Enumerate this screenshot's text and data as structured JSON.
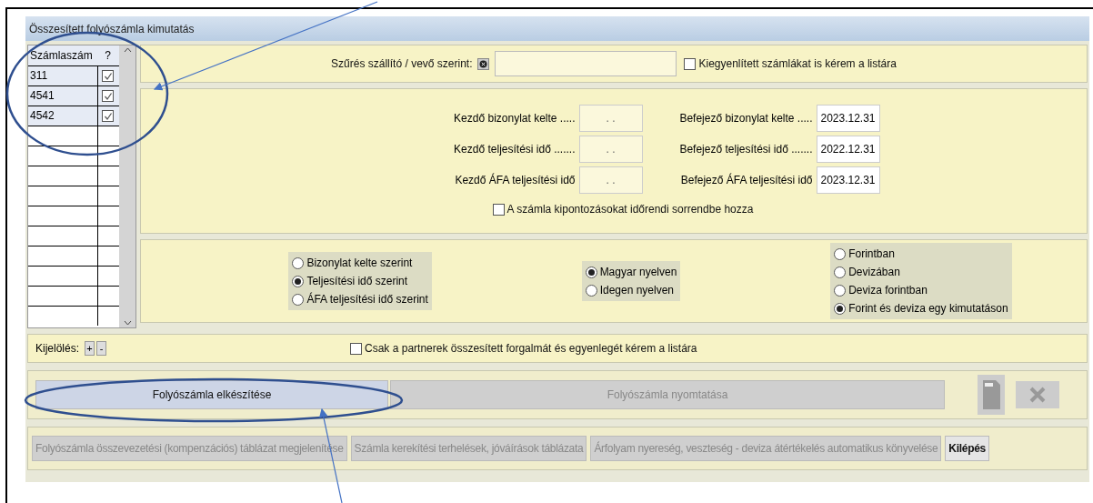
{
  "window": {
    "title": "Összesített folyószámla kimutatás"
  },
  "accounts_table": {
    "columns": [
      "Számlaszám",
      "?"
    ],
    "rows": [
      {
        "number": "311",
        "checked": true
      },
      {
        "number": "4541",
        "checked": true
      },
      {
        "number": "4542",
        "checked": true
      }
    ]
  },
  "filter": {
    "label": "Szűrés szállító / vevő szerint:",
    "checkbox": {
      "label": "Kiegyenlített számlákat is kérem a listára",
      "checked": false
    }
  },
  "dates": {
    "rows": [
      {
        "start_label": "Kezdő bizonylat kelte .....",
        "start_value": ". .",
        "end_label": "Befejező bizonylat kelte .....",
        "end_value": "2023.12.31"
      },
      {
        "start_label": "Kezdő teljesítési idő .......",
        "start_value": ". .",
        "end_label": "Befejező teljesítési idő .......",
        "end_value": "2022.12.31"
      },
      {
        "start_label": "Kezdő ÁFA teljesítési idő",
        "start_value": ". .",
        "end_label": "Befejező ÁFA teljesítési idő",
        "end_value": "2023.12.31"
      }
    ],
    "checkbox": {
      "label": "A számla kipontozásokat időrendi sorrendbe hozza",
      "checked": false
    }
  },
  "radio_groups": [
    {
      "options": [
        {
          "label": "Bizonylat kelte szerint",
          "selected": false
        },
        {
          "label": "Teljesítési idő szerint",
          "selected": true
        },
        {
          "label": "ÁFA teljesítési idő szerint",
          "selected": false
        }
      ]
    },
    {
      "options": [
        {
          "label": "Magyar nyelven",
          "selected": true
        },
        {
          "label": "Idegen nyelven",
          "selected": false
        }
      ]
    },
    {
      "options": [
        {
          "label": "Forintban",
          "selected": false
        },
        {
          "label": "Devizában",
          "selected": false
        },
        {
          "label": "Deviza forintban",
          "selected": false
        },
        {
          "label": "Forint és deviza egy kimutatáson",
          "selected": true
        }
      ]
    }
  ],
  "selection": {
    "label": "Kijelölés:",
    "buttons": [
      "+",
      "-"
    ],
    "checkbox": {
      "label": "Csak a partnerek összesített forgalmát és egyenlegét kérem a listára",
      "checked": false
    }
  },
  "actions": {
    "buttons": [
      {
        "label": "Folyószámla elkészítése",
        "disabled": false
      },
      {
        "label": "Folyószámla nyomtatása",
        "disabled": true
      }
    ]
  },
  "bottom_buttons": [
    {
      "label": "Folyószámla összevezetési (kompenzációs) táblázat megjelenítése",
      "disabled": true
    },
    {
      "label": "Számla kerekítési terhelések, jóváírások táblázata",
      "disabled": true
    },
    {
      "label": "Árfolyam nyereség, veszteség - deviza átértékelés automatikus könyvelése",
      "disabled": true
    },
    {
      "label": "Kilépés",
      "disabled": false
    }
  ]
}
